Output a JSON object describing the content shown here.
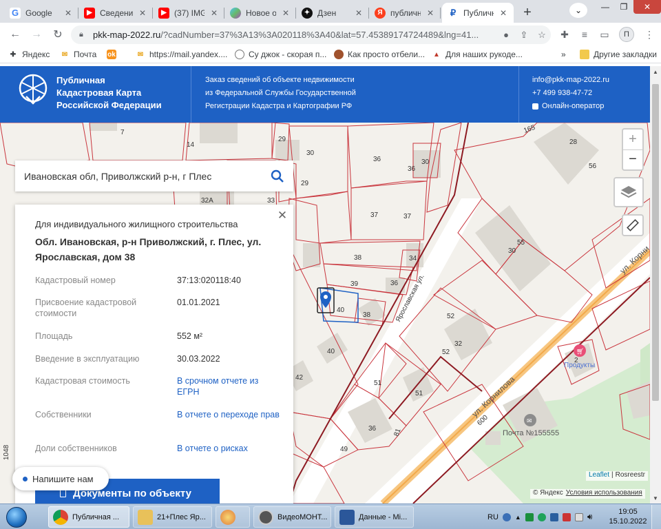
{
  "browser": {
    "tabs": [
      {
        "label": "Google",
        "icon": "google-icon"
      },
      {
        "label": "Сведени",
        "icon": "youtube-icon"
      },
      {
        "label": "(37) IMG",
        "icon": "youtube-icon"
      },
      {
        "label": "Новое о",
        "icon": "app-icon"
      },
      {
        "label": "Дзен",
        "icon": "zen-icon"
      },
      {
        "label": "публичн",
        "icon": "yandex-icon"
      },
      {
        "label": "Публичн",
        "icon": "pkk-icon"
      }
    ],
    "url_host": "pkk-map-2022.ru",
    "url_rest": "/?cadNumber=37%3A13%3A020118%3A40&lat=57.45389174724489&lng=41...",
    "profile_initial": "П",
    "bookmarks": [
      "Яндекс",
      "Почта",
      "",
      "https://mail.yandex....",
      "Су джок - скорая п...",
      "Как просто отбели...",
      "Для наших рукоде..."
    ],
    "bookmarks_more": "»",
    "other_bookmarks": "Другие закладки"
  },
  "site": {
    "brand_line1": "Публичная",
    "brand_line2": "Кадастровая Карта",
    "brand_line3": "Российской Федерации",
    "info_line1": "Заказ сведений об объекте недвижимости",
    "info_line2": "из Федеральной Службы Государственной",
    "info_line3": "Регистрации Кадастра и Картографии РФ",
    "email": "info@pkk-map-2022.ru",
    "phone": "+7 499 938-47-72",
    "online": "Онлайн-оператор"
  },
  "search": {
    "query": "Ивановская обл, Приволжский р-н, г Плес"
  },
  "panel": {
    "type": "Для индивидуального жилищного строительства",
    "address": "Обл. Ивановская, р-н Приволжский, г. Плес, ул. Ярославская, дом 38",
    "rows": [
      {
        "key": "Кадастровый номер",
        "value": "37:13:020118:40",
        "link": false
      },
      {
        "key": "Присвоение кадастровой стоимости",
        "value": "01.01.2021",
        "link": false
      },
      {
        "key": "Площадь",
        "value": "552 м²",
        "link": false
      },
      {
        "key": "Введение в эксплуатацию",
        "value": "30.03.2022",
        "link": false
      },
      {
        "key": "Кадастровая стоимость",
        "value": "В срочном отчете из ЕГРН",
        "link": true
      },
      {
        "key": "Собственники",
        "value": "В отчете о переходе прав",
        "link": true
      },
      {
        "key": "Доли собственников",
        "value": "В отчете о рисках",
        "link": true
      }
    ],
    "button": "Документы по объекту"
  },
  "chat": {
    "label": "Напишите нам"
  },
  "map": {
    "zoom_in": "+",
    "zoom_out": "−",
    "attrib_leaflet": "Leaflet",
    "attrib_sep": "|",
    "attrib_rosreestr": "Rosreestr",
    "yandex_attrib": "© Яндекс",
    "yandex_terms": "Условия использования",
    "street_yaroslavskaya": "Ярославская ул.",
    "street_kornilova": "ул. Корнилова",
    "street_kornilova_top": "ул. Корни",
    "num_600": "600",
    "poi_produkty": "Продукты",
    "poi_pochta": "Почта №155555",
    "labels": [
      "7",
      "14",
      "29",
      "30",
      "36",
      "36",
      "30",
      "28",
      "56",
      "29",
      "32А",
      "33",
      "37",
      "37",
      "55",
      "30",
      "38",
      "34",
      "39",
      "36",
      "40",
      "38",
      "52",
      "32",
      "52",
      "40",
      "42",
      "51",
      "51",
      "36",
      "49",
      "1048",
      "165",
      "2",
      "81"
    ]
  },
  "taskbar": {
    "items": [
      {
        "label": "Публичная ...",
        "icon": "chrome-icon"
      },
      {
        "label": "21+Плес Яр...",
        "icon": "folder-icon"
      },
      {
        "label": "",
        "icon": "paint-icon"
      },
      {
        "label": "ВидеоМОНТ...",
        "icon": "video-icon"
      },
      {
        "label": "Данные - Mi...",
        "icon": "word-icon"
      }
    ],
    "lang": "RU",
    "time": "19:05",
    "date": "15.10.2022"
  }
}
